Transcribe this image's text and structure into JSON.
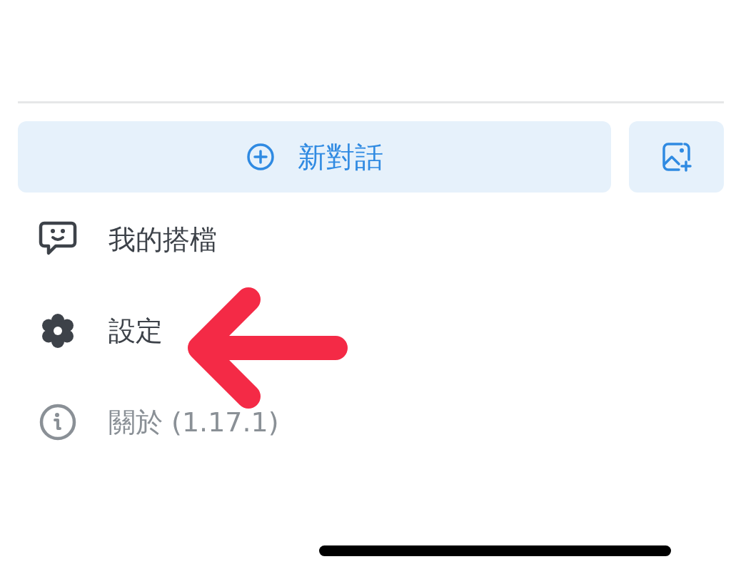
{
  "new_chat_button": {
    "label": "新對話"
  },
  "menu": [
    {
      "label": "我的搭檔",
      "muted": false
    },
    {
      "label": "設定",
      "muted": false
    },
    {
      "label": "關於 (1.17.1)",
      "muted": true
    }
  ]
}
